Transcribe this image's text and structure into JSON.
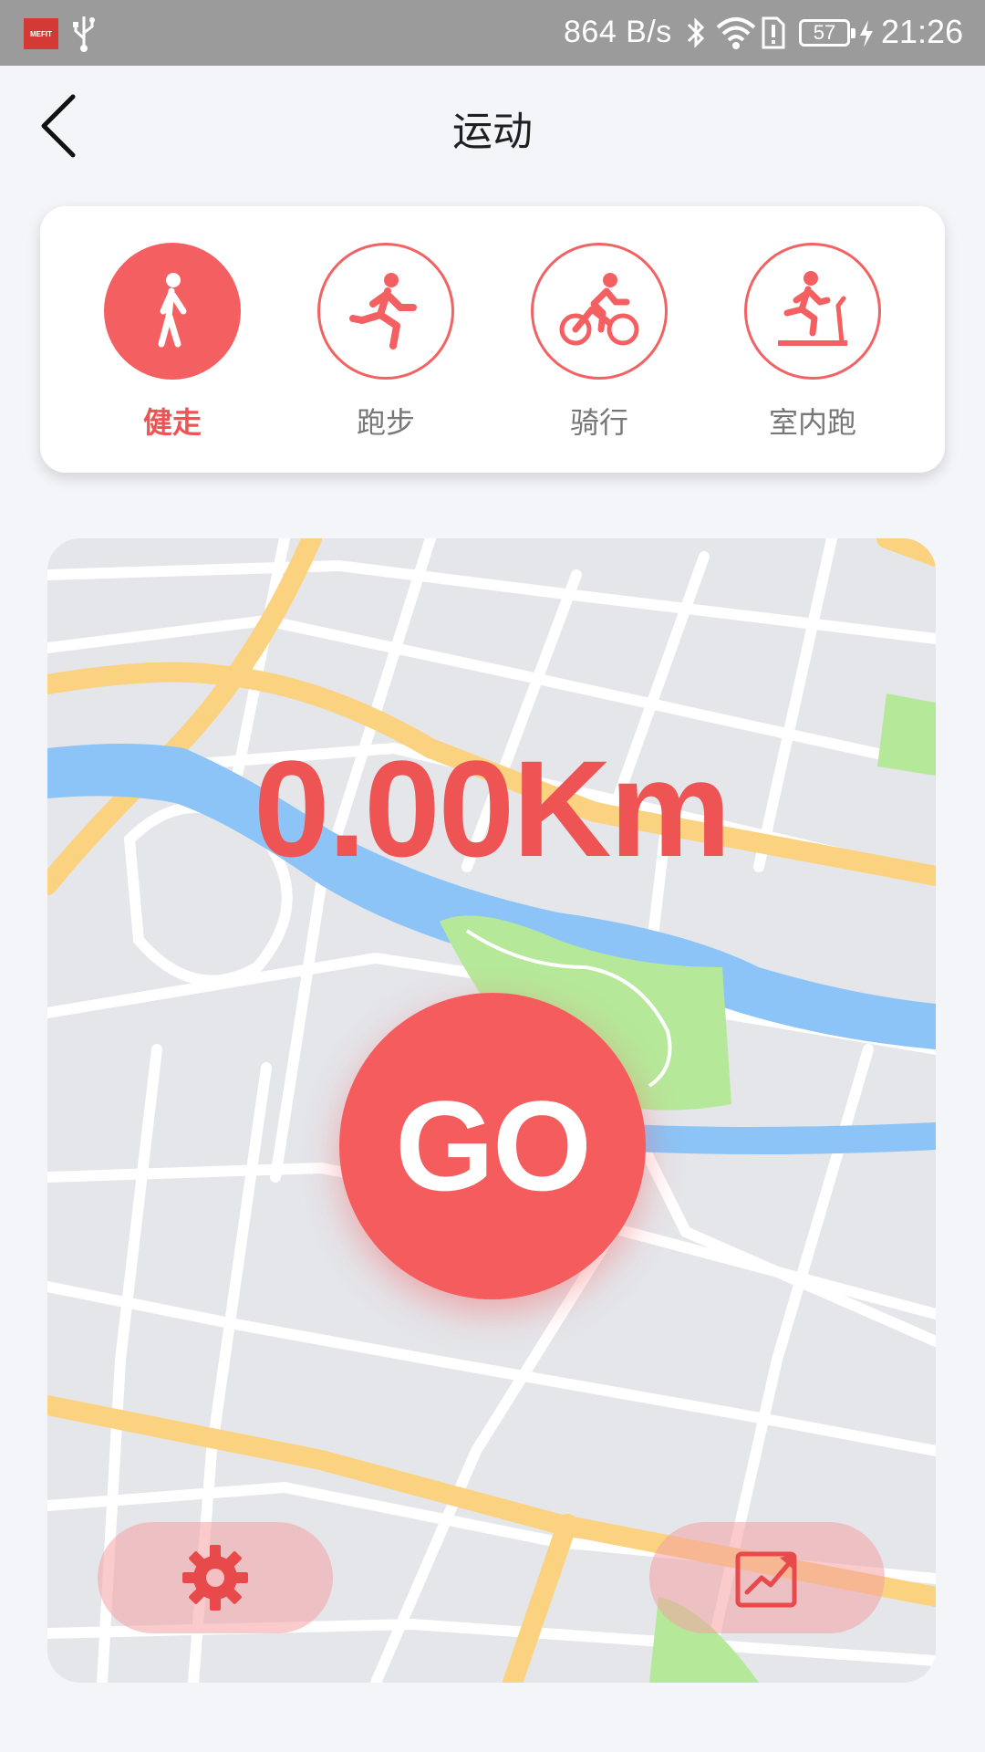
{
  "status_bar": {
    "app_badge": "MEFIT",
    "network_speed": "864 B/s",
    "battery_level": "57",
    "time": "21:26"
  },
  "header": {
    "title": "运动",
    "back_icon": "chevron-left-icon"
  },
  "sport_types": [
    {
      "label": "健走",
      "icon": "walking-icon",
      "active": true
    },
    {
      "label": "跑步",
      "icon": "running-icon",
      "active": false
    },
    {
      "label": "骑行",
      "icon": "cycling-icon",
      "active": false
    },
    {
      "label": "室内跑",
      "icon": "treadmill-icon",
      "active": false
    }
  ],
  "workout": {
    "distance": "0.00Km",
    "go_label": "GO"
  },
  "controls": {
    "settings_icon": "gear-icon",
    "stats_icon": "trend-chart-icon"
  },
  "colors": {
    "accent": "#f45f61",
    "status_bar": "#9b9b9b",
    "background": "#f4f5f9",
    "map_base": "#e4e6ea",
    "map_major_road": "#fbd27f",
    "map_river": "#8cc4f7",
    "map_park": "#b6e89a"
  }
}
